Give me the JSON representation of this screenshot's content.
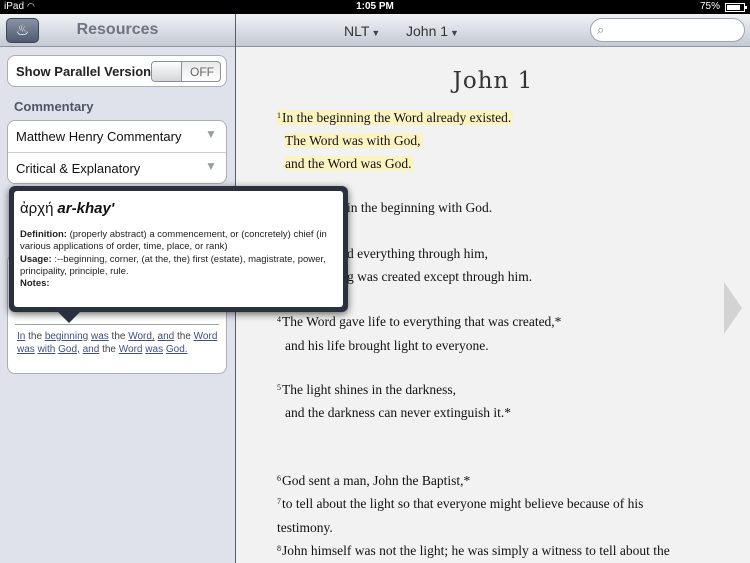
{
  "status": {
    "device": "iPad",
    "time": "1:05 PM",
    "battery": "75%"
  },
  "left": {
    "title": "Resources",
    "parallel_label": "Show Parallel Version",
    "toggle_state": "OFF",
    "section": "Commentary",
    "commentaries": [
      {
        "label": "Matthew Henry Commentary"
      },
      {
        "label": "Critical & Explanatory"
      }
    ],
    "verse_words": [
      "In",
      "the",
      "beginning",
      "was",
      "the",
      "Word,",
      "and",
      "the",
      "Word",
      "was",
      "with",
      "God,",
      "and",
      "the",
      "Word",
      "was",
      "God."
    ]
  },
  "toolbar": {
    "version": "NLT",
    "book": "John 1",
    "search_placeholder": ""
  },
  "chapter": {
    "title": "John 1",
    "lines": [
      {
        "num": "1",
        "text": "In the beginning the Word already existed."
      },
      {
        "num": "",
        "text": "The Word was with God,"
      },
      {
        "num": "",
        "text": "and the Word was God."
      },
      {
        "num": "",
        "text": "in the beginning with God."
      },
      {
        "num": "",
        "text": "d everything through him,"
      },
      {
        "num": "",
        "text": "g was created except through him."
      },
      {
        "num": "4",
        "text": "The Word gave life to everything that was created,*"
      },
      {
        "num": "",
        "text": "and his life brought light to everyone."
      },
      {
        "num": "5",
        "text": "The light shines in the darkness,"
      },
      {
        "num": "",
        "text": "and the darkness can never extinguish it.*"
      },
      {
        "num": "6",
        "text": "God sent a man, John the Baptist,*"
      },
      {
        "num": "7",
        "text": "to tell about the light so that everyone might believe because of his"
      },
      {
        "num": "",
        "text": "testimony."
      },
      {
        "num": "8",
        "text": "John himself was not the light; he was simply a witness to tell about the"
      }
    ]
  },
  "popover": {
    "greek": "ἀρχή",
    "translit": "ar-khay'",
    "definition_label": "Definition:",
    "definition": "(properly abstract) a commencement, or (concretely) chief (in various applications of order, time, place, or rank)",
    "usage_label": "Usage:",
    "usage": ":--beginning, corner, (at the, the) first (estate), magistrate, power, principality, principle, rule.",
    "notes_label": "Notes:"
  }
}
